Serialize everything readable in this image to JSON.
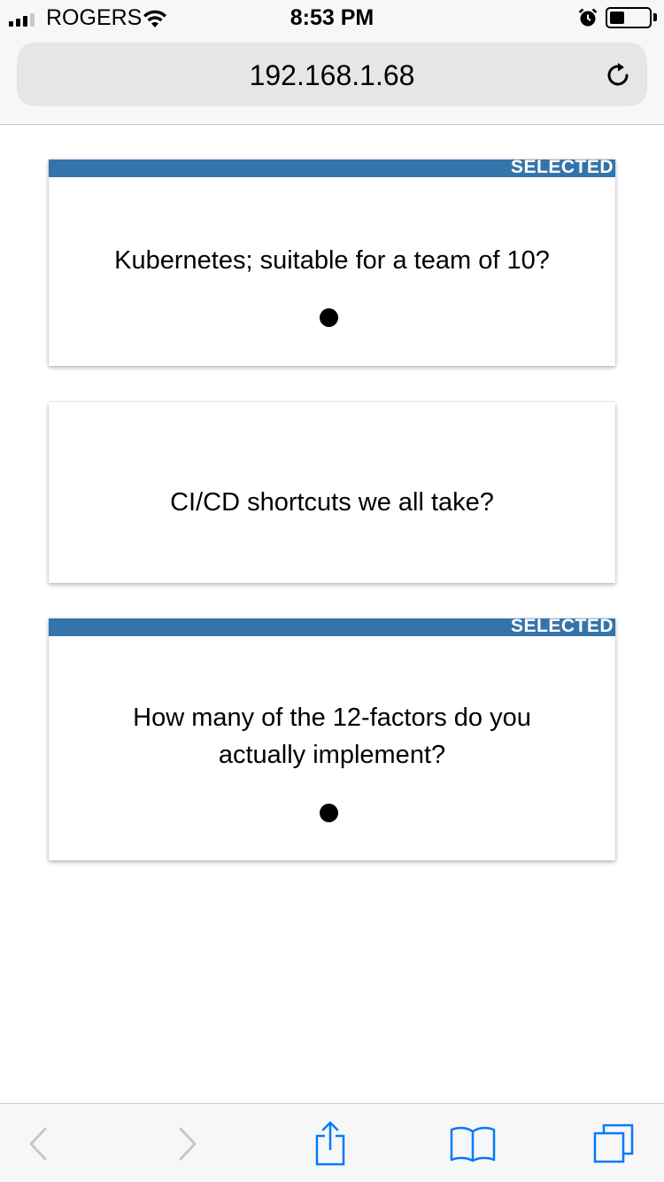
{
  "status_bar": {
    "carrier": "ROGERS",
    "time": "8:53 PM",
    "signal_bars_filled": 3,
    "signal_bars_total": 4,
    "icons": [
      "signal-icon",
      "wifi-icon",
      "alarm-icon",
      "battery-icon"
    ]
  },
  "browser": {
    "url": "192.168.1.68",
    "reload_icon": "reload-icon"
  },
  "cards": [
    {
      "selected": true,
      "badge": "SELECTED",
      "question": "Kubernetes; suitable for a team of 10?",
      "has_dot": true
    },
    {
      "selected": false,
      "badge": "",
      "question": "CI/CD shortcuts we all take?",
      "has_dot": false
    },
    {
      "selected": true,
      "badge": "SELECTED",
      "question": "How many of the 12-factors do you actually implement?",
      "has_dot": true
    }
  ],
  "toolbar": {
    "back_icon": "back-chevron-icon",
    "forward_icon": "forward-chevron-icon",
    "share_icon": "share-icon",
    "bookmarks_icon": "bookmarks-icon",
    "tabs_icon": "tabs-icon"
  },
  "colors": {
    "accent_bar": "#3574aa",
    "toolbar_icon_active": "#007aff",
    "toolbar_icon_disabled": "#c7c7cc"
  }
}
